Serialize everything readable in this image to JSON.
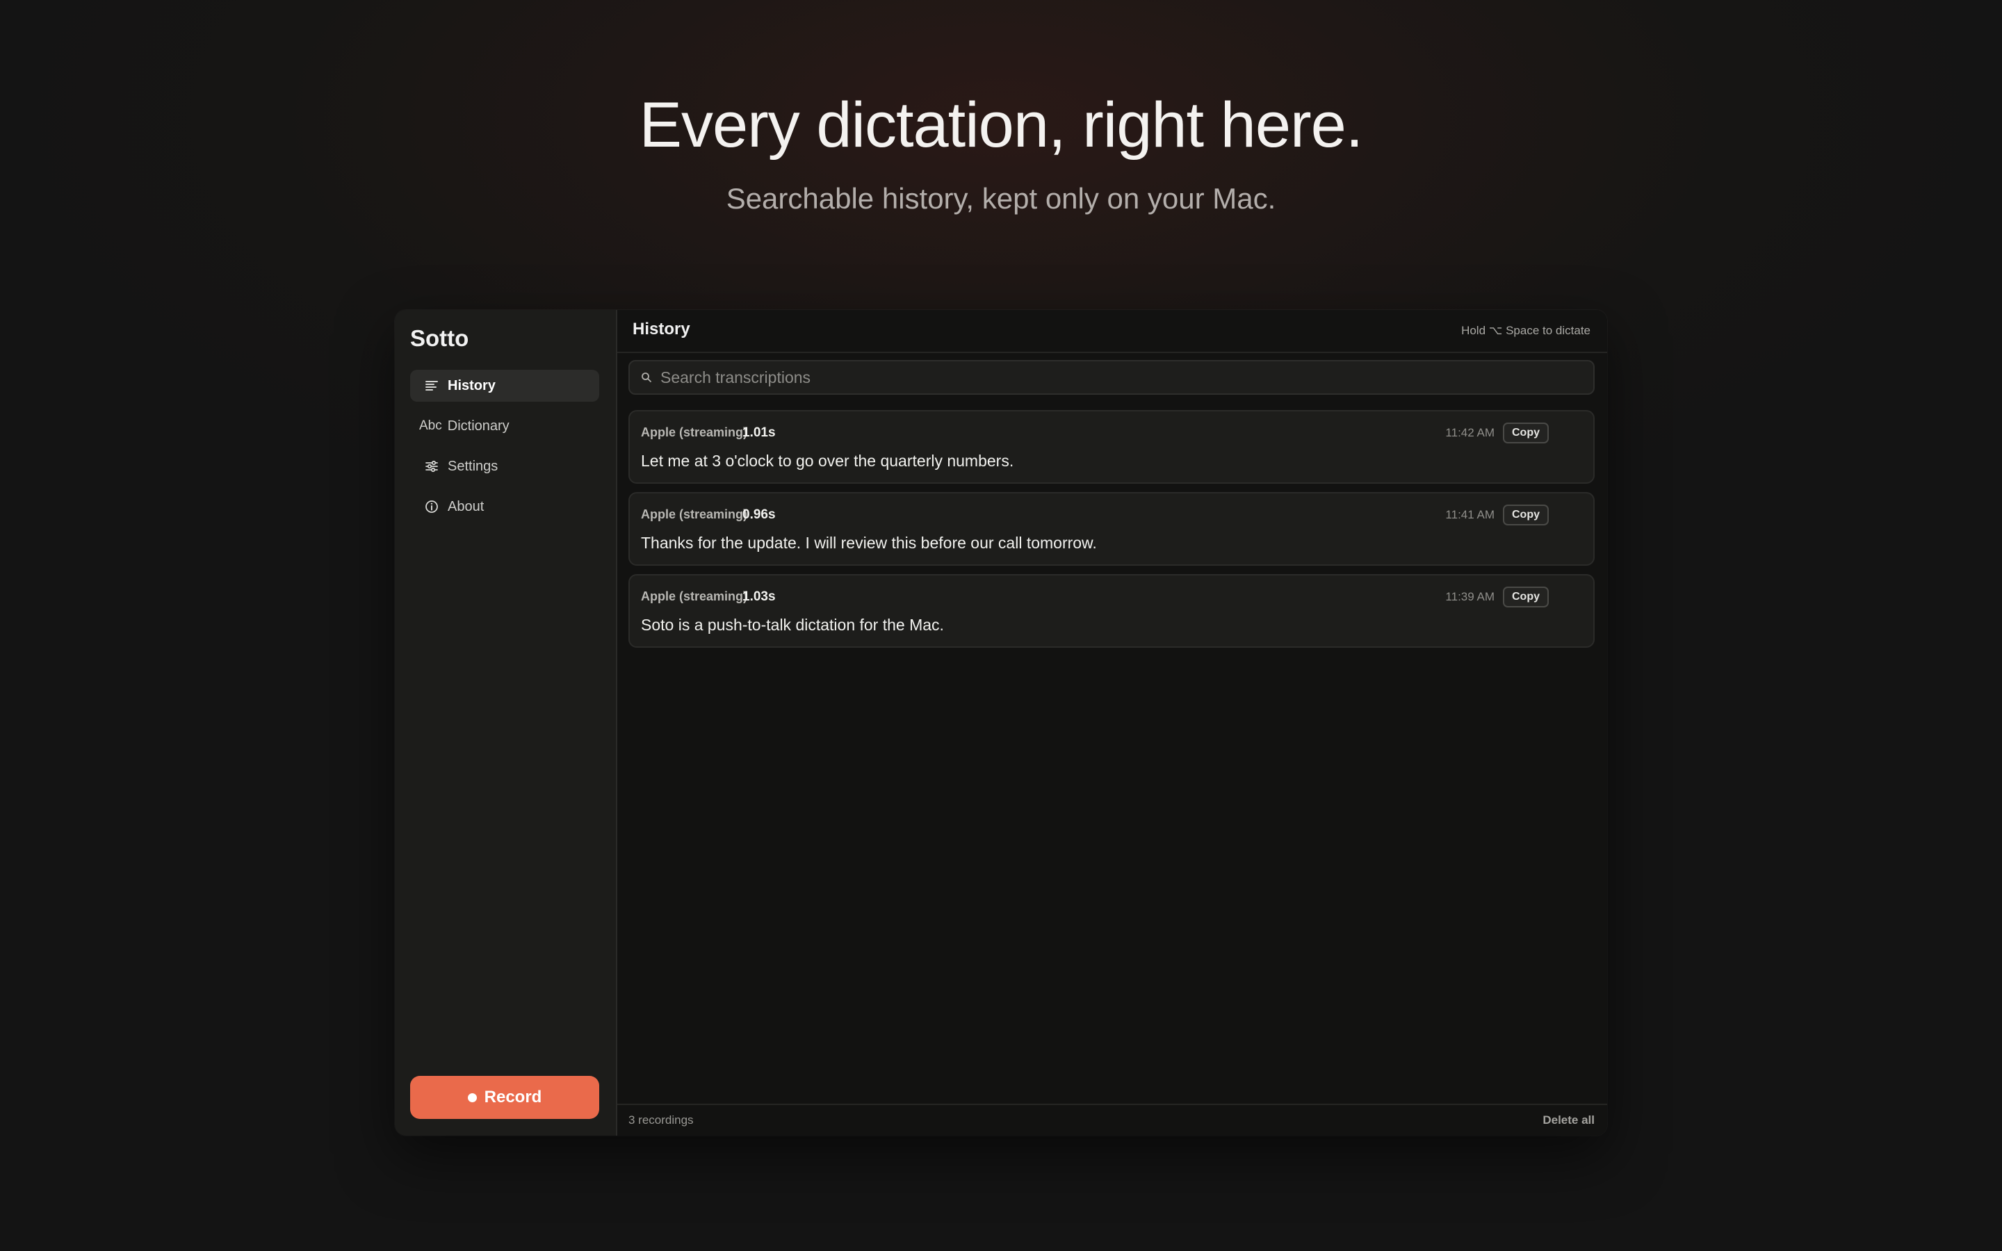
{
  "hero": {
    "title": "Every dictation, right here.",
    "subtitle": "Searchable history, kept only on your Mac."
  },
  "app": {
    "name": "Sotto",
    "accent_color": "#ea6a4b"
  },
  "sidebar": {
    "items": [
      {
        "label": "History",
        "icon": "list-icon",
        "active": true
      },
      {
        "label": "Dictionary",
        "icon": "abc-icon",
        "icon_text": "Abc",
        "active": false
      },
      {
        "label": "Settings",
        "icon": "sliders-icon",
        "active": false
      },
      {
        "label": "About",
        "icon": "info-icon",
        "active": false
      }
    ],
    "record_label": "Record"
  },
  "main": {
    "title": "History",
    "shortcut_hint": "Hold ⌥ Space to dictate",
    "search_placeholder": "Search transcriptions",
    "search_value": "",
    "entries": [
      {
        "engine": "Apple (streaming)",
        "duration": "1.01s",
        "time": "11:42 AM",
        "copy_label": "Copy",
        "text": "Let me at 3 o'clock to go over the quarterly numbers."
      },
      {
        "engine": "Apple (streaming)",
        "duration": "0.96s",
        "time": "11:41 AM",
        "copy_label": "Copy",
        "text": "Thanks for the update. I will review this before our call tomorrow."
      },
      {
        "engine": "Apple (streaming)",
        "duration": "1.03s",
        "time": "11:39 AM",
        "copy_label": "Copy",
        "text": "Soto is a push-to-talk dictation for the Mac."
      }
    ],
    "footer": {
      "count": "3 recordings",
      "delete_label": "Delete all"
    }
  }
}
